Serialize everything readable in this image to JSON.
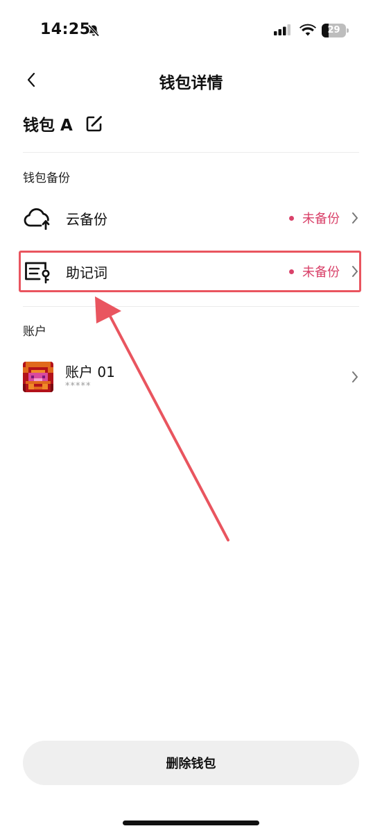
{
  "status_bar": {
    "time": "14:25",
    "battery": "29",
    "battery_level": 0.29
  },
  "nav": {
    "title": "钱包详情"
  },
  "wallet": {
    "name": "钱包 A"
  },
  "backup_section": {
    "title": "钱包备份",
    "items": [
      {
        "label": "云备份",
        "status": "未备份",
        "icon": "cloud-upload-icon"
      },
      {
        "label": "助记词",
        "status": "未备份",
        "icon": "mnemonic-key-icon"
      }
    ]
  },
  "accounts_section": {
    "title": "账户",
    "items": [
      {
        "name": "账户 01",
        "subtitle": "*****"
      }
    ]
  },
  "footer": {
    "delete_label": "删除钱包"
  },
  "colors": {
    "accent": "#d9426a",
    "highlight": "#e9555f",
    "button_bg": "#efefef"
  }
}
